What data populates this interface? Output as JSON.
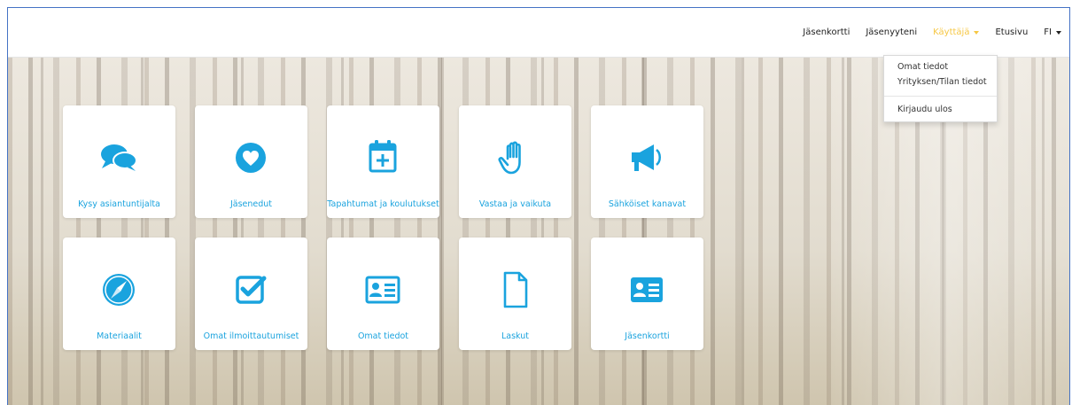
{
  "navbar": {
    "links": [
      {
        "label": "Jäsenkortti"
      },
      {
        "label": "Jäsenyyteni"
      },
      {
        "label": "Käyttäjä"
      },
      {
        "label": "Etusivu"
      },
      {
        "label": "FI"
      }
    ]
  },
  "dropdown": {
    "items": [
      {
        "label": "Omat tiedot"
      },
      {
        "label": "Yrityksen/Tilan tiedot"
      },
      {
        "label": "Kirjaudu ulos"
      }
    ]
  },
  "tiles": [
    {
      "label": "Kysy asiantuntijalta",
      "icon": "chat-bubbles-icon"
    },
    {
      "label": "Jäsenedut",
      "icon": "heart-circle-icon"
    },
    {
      "label": "Tapahtumat ja koulutukset",
      "icon": "calendar-plus-icon"
    },
    {
      "label": "Vastaa ja vaikuta",
      "icon": "hand-icon"
    },
    {
      "label": "Sähköiset kanavat",
      "icon": "megaphone-icon"
    },
    {
      "label": "Materiaalit",
      "icon": "compass-icon"
    },
    {
      "label": "Omat ilmoittautumiset",
      "icon": "checkbox-icon"
    },
    {
      "label": "Omat tiedot",
      "icon": "id-card-icon"
    },
    {
      "label": "Laskut",
      "icon": "document-icon"
    },
    {
      "label": "Jäsenkortti",
      "icon": "member-card-icon"
    }
  ],
  "colors": {
    "accent": "#1aa3de",
    "active_nav": "#f6c744"
  }
}
